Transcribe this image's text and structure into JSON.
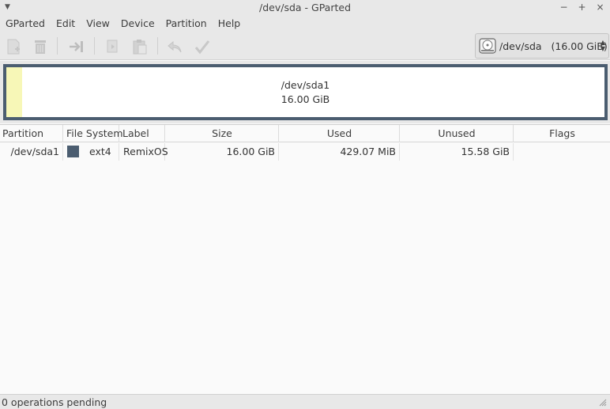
{
  "window": {
    "title": "/dev/sda - GParted",
    "controls": {
      "minimize": "−",
      "maximize": "+",
      "close": "×"
    }
  },
  "menu": [
    "GParted",
    "Edit",
    "View",
    "Device",
    "Partition",
    "Help"
  ],
  "toolbar": {
    "buttons": [
      "new-icon",
      "delete-icon",
      "resize-move-icon",
      "copy-icon",
      "paste-icon",
      "undo-icon",
      "apply-icon"
    ],
    "enabled": false
  },
  "device_selector": {
    "device": "/dev/sda",
    "size": "(16.00 GiB)"
  },
  "disk_map": {
    "partition": "/dev/sda1",
    "size": "16.00 GiB",
    "used_fraction": 0.026,
    "used_color": "#f7f7b7",
    "border_color": "#4b5d70"
  },
  "table": {
    "columns": [
      "Partition",
      "File System",
      "Label",
      "Size",
      "Used",
      "Unused",
      "Flags"
    ],
    "rows": [
      {
        "partition": "/dev/sda1",
        "filesystem": "ext4",
        "fs_color": "#4b5d70",
        "label": "RemixOS",
        "size": "16.00 GiB",
        "used": "429.07 MiB",
        "unused": "15.58 GiB",
        "flags": ""
      }
    ]
  },
  "status": {
    "text": "0 operations pending"
  }
}
